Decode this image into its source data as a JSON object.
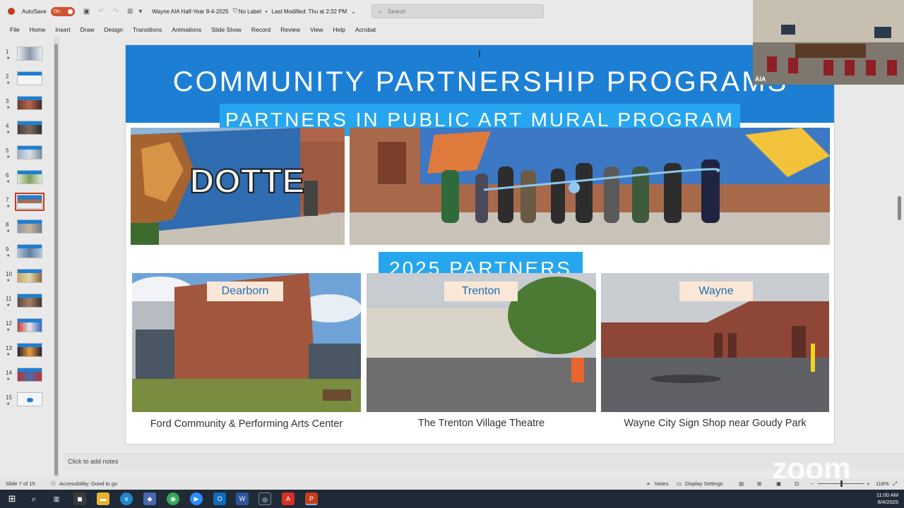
{
  "titlebar": {
    "autosave": "AutoSave",
    "toggle": "On",
    "doc_title": "Wayne AIA Half-Year 8-4-2025",
    "label_status": "No Label",
    "modified": "Last Modified: Thu at 2:32 PM",
    "search_placeholder": "Search"
  },
  "menu": [
    "File",
    "Home",
    "Insert",
    "Draw",
    "Design",
    "Transitions",
    "Animations",
    "Slide Show",
    "Record",
    "Review",
    "View",
    "Help",
    "Acrobat"
  ],
  "thumbnails": [
    "1",
    "2",
    "3",
    "4",
    "5",
    "6",
    "7",
    "8",
    "9",
    "10",
    "11",
    "12",
    "13",
    "14",
    "15"
  ],
  "active_slide": "7",
  "slide": {
    "title": "COMMUNITY PARTNERSHIP PROGRAMS",
    "subtitle": "PARTNERS IN PUBLIC ART MURAL PROGRAM",
    "mural_text": "DOTTE",
    "partners_heading": "2025 PARTNERS",
    "partners": [
      {
        "city": "Dearborn",
        "caption": "Ford Community & Performing Arts Center"
      },
      {
        "city": "Trenton",
        "caption": "The Trenton Village Theatre"
      },
      {
        "city": "Wayne",
        "caption": "Wayne City Sign Shop near Goudy Park"
      }
    ]
  },
  "video": {
    "name": "AIA"
  },
  "notes": {
    "placeholder": "Click to add notes"
  },
  "zoom_logo": "zoom",
  "status": {
    "slide_of": "Slide 7 of 15",
    "accessibility": "Accessibility: Good to go",
    "notes": "Notes",
    "display": "Display Settings",
    "zoom": "118%"
  },
  "clock": {
    "time": "11:00 AM",
    "date": "8/4/2025"
  },
  "colors": {
    "header_blue": "#1d7fd4",
    "accent_blue": "#26a6ef",
    "tag_bg": "#fbe7d8",
    "ppt_red": "#c43e1c"
  }
}
